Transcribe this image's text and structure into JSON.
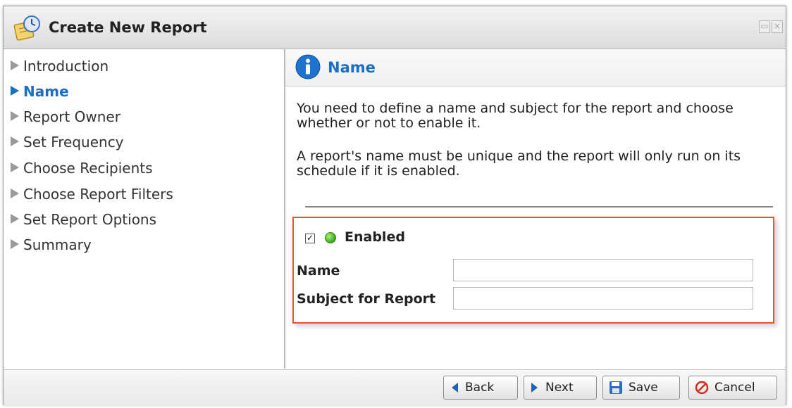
{
  "window": {
    "title": "Create New Report",
    "title_icon": "report-schedule-icon",
    "controls": [
      {
        "name": "restore-icon",
        "glyph": "▭"
      },
      {
        "name": "close-icon",
        "glyph": "×"
      }
    ]
  },
  "sidebar": {
    "items": [
      {
        "label": "Introduction",
        "active": false
      },
      {
        "label": "Name",
        "active": true
      },
      {
        "label": "Report Owner",
        "active": false
      },
      {
        "label": "Set Frequency",
        "active": false
      },
      {
        "label": "Choose Recipients",
        "active": false
      },
      {
        "label": "Choose Report Filters",
        "active": false
      },
      {
        "label": "Set Report Options",
        "active": false
      },
      {
        "label": "Summary",
        "active": false
      }
    ]
  },
  "main": {
    "title": "Name",
    "title_icon": "info-icon",
    "description": [
      "You need to define a name and subject for the report and choose whether or not to enable it.",
      "A report's name must be unique and the report will only run on its schedule if it is enabled."
    ],
    "form": {
      "enabled_label": "Enabled",
      "enabled_checked": true,
      "enabled_glyph": "✓",
      "name_label": "Name",
      "name_value": "",
      "subject_label": "Subject for Report",
      "subject_value": ""
    }
  },
  "footer": {
    "buttons": [
      {
        "label": "Back",
        "icon": "back-arrow-icon"
      },
      {
        "label": "Next",
        "icon": "next-arrow-icon"
      },
      {
        "label": "Save",
        "icon": "save-disk-icon"
      },
      {
        "label": "Cancel",
        "icon": "cancel-icon"
      }
    ]
  },
  "colors": {
    "accent": "#1a6fc4",
    "highlight_border": "#e8542b",
    "enabled_dot": "#3ea51c"
  }
}
